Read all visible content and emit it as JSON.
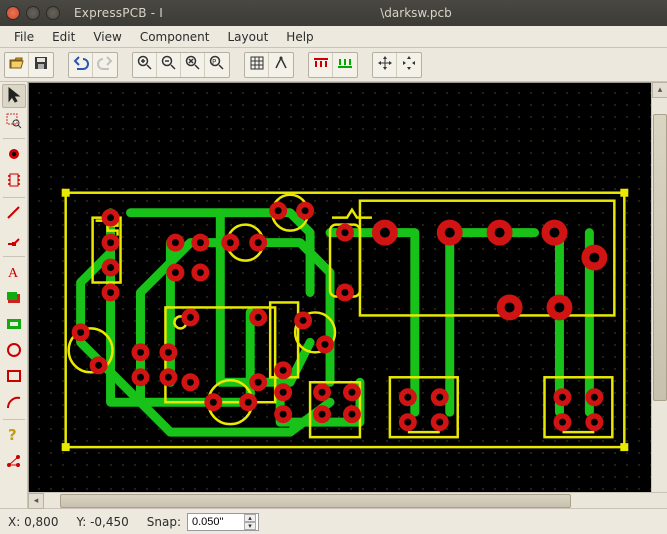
{
  "title": {
    "app_left": "ExpressPCB - I",
    "app_right": "\\darksw.pcb"
  },
  "menu": {
    "file": "File",
    "edit": "Edit",
    "view": "View",
    "component": "Component",
    "layout": "Layout",
    "help": "Help"
  },
  "toolbar": {
    "open": "Open",
    "save": "Save",
    "undo": "Undo",
    "redo": "Redo",
    "zoom_in": "Zoom In",
    "zoom_out": "Zoom Out",
    "zoom_fit": "Zoom Fit",
    "zoom_prev": "Zoom Previous",
    "grid": "Toggle Grid",
    "snap": "Snap Toggle",
    "top_layer": "Top Layer",
    "bottom_layer": "Bottom Layer",
    "move": "Move",
    "rotate": "Rotate/Align"
  },
  "sidebar": {
    "select": "Select",
    "zoom": "Zoom Area",
    "pad": "Place Pad",
    "component": "Place Component",
    "trace": "Place Trace",
    "corner": "Place Corner",
    "text": "Place Text",
    "rect_fill": "Place Filled Rect",
    "plane": "Place Plane",
    "circle": "Place Circle",
    "rect": "Place Rectangle",
    "arc": "Place Arc",
    "info": "Info",
    "net": "Highlight Net"
  },
  "status": {
    "x_label": "X:",
    "x_value": "0,800",
    "y_label": "Y:",
    "y_value": "-0,450",
    "snap_label": "Snap:",
    "snap_value": "0.050\""
  },
  "colors": {
    "outline": "#e8e800",
    "trace": "#18c218",
    "pad_fill": "#d01414",
    "pad_dark": "#8a0c0c",
    "grid": "#2b2b12",
    "handle": "#e8e800"
  }
}
